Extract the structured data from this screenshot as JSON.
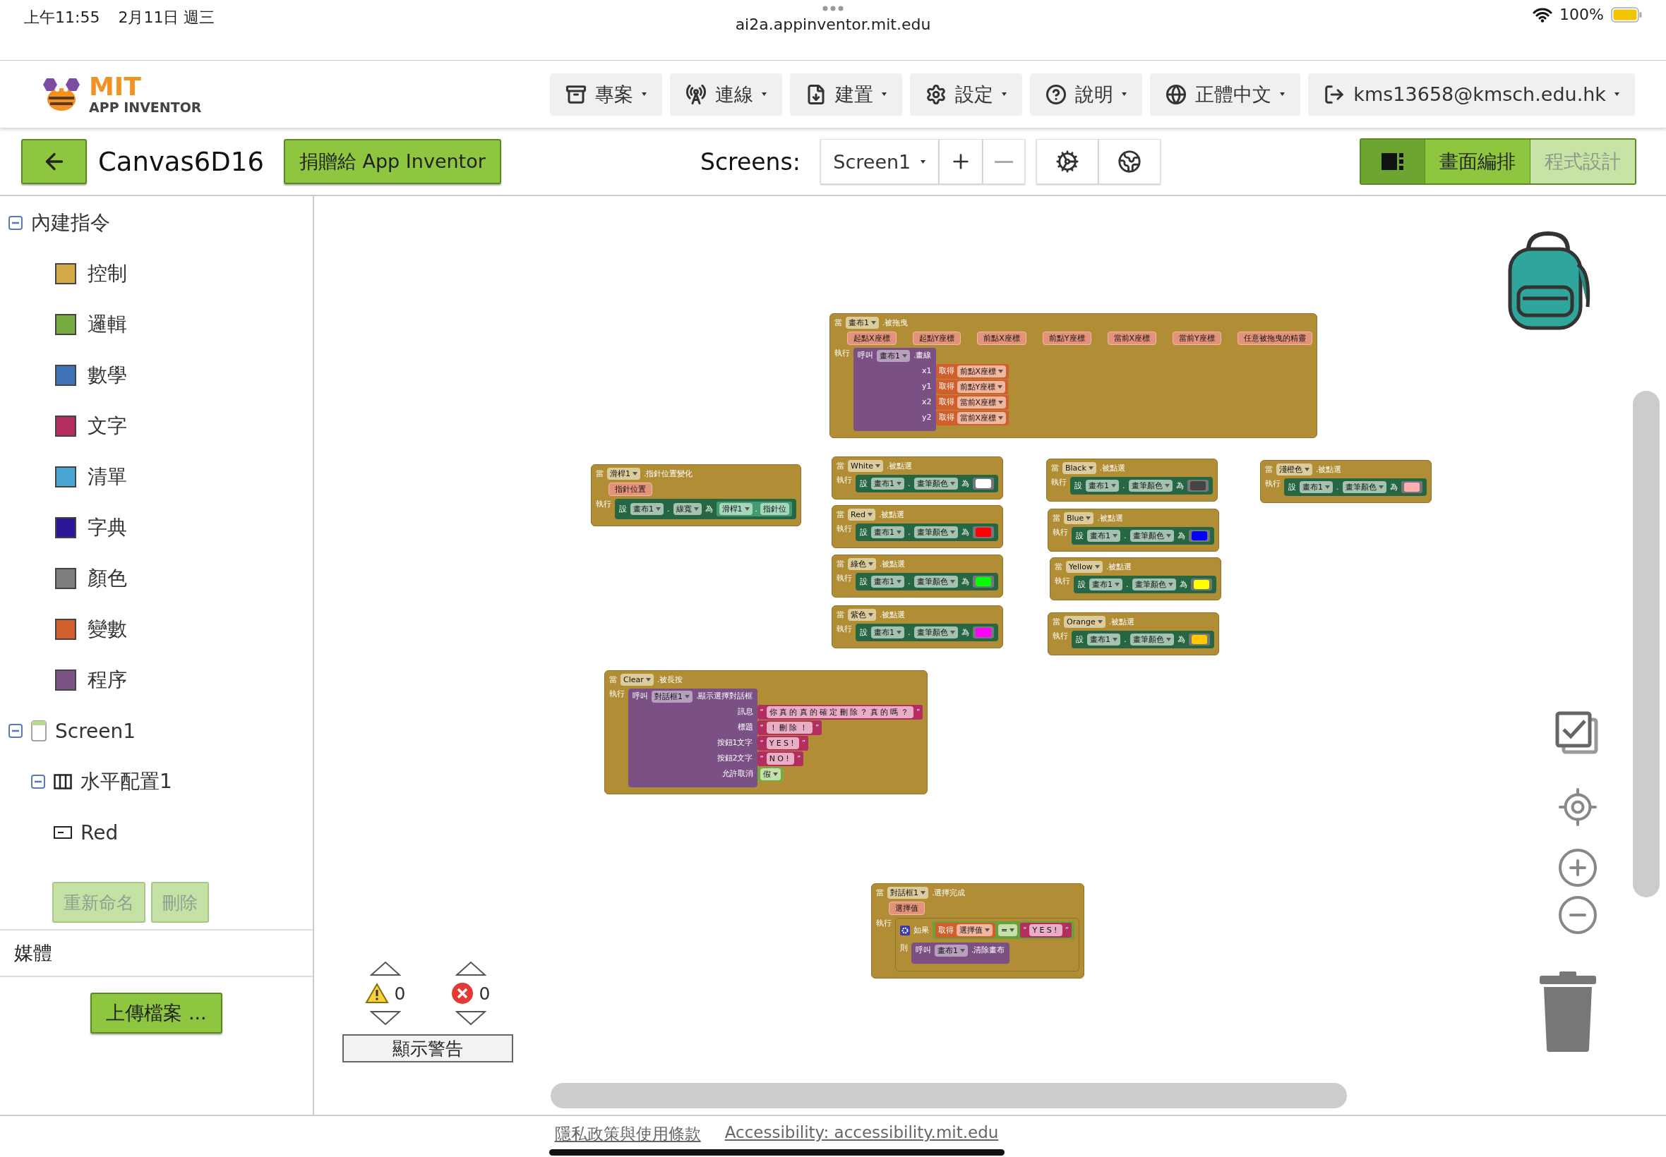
{
  "status_bar": {
    "time": "上午11:55",
    "date": "2月11日 週三",
    "url": "ai2a.appinventor.mit.edu",
    "battery": "100%"
  },
  "header": {
    "logo_title": "MIT",
    "logo_subtitle": "APP INVENTOR",
    "menus": [
      {
        "label": "專案"
      },
      {
        "label": "連線"
      },
      {
        "label": "建置"
      },
      {
        "label": "設定"
      },
      {
        "label": "說明"
      },
      {
        "label": "正體中文"
      },
      {
        "label": "kms13658@kmsch.edu.hk"
      }
    ]
  },
  "toolbar": {
    "project_name": "Canvas6D16",
    "donate": "捐贈給 App Inventor",
    "screens_label": "Screens:",
    "screen": "Screen1",
    "add_disabled": false,
    "remove_disabled": true,
    "editor_tabs": [
      {
        "label": "畫面編排",
        "selected": false
      },
      {
        "label": "程式設計",
        "selected": true
      }
    ]
  },
  "sidebar": {
    "tree": [
      {
        "kind": "group",
        "label": "內建指令",
        "expanded": true,
        "children": [
          {
            "kind": "category",
            "label": "控制",
            "color": "#d4aa48"
          },
          {
            "kind": "category",
            "label": "邏輯",
            "color": "#77ab41"
          },
          {
            "kind": "category",
            "label": "數學",
            "color": "#3f71b5"
          },
          {
            "kind": "category",
            "label": "文字",
            "color": "#b32d5e"
          },
          {
            "kind": "category",
            "label": "清單",
            "color": "#49a6d4"
          },
          {
            "kind": "category",
            "label": "字典",
            "color": "#2d1799"
          },
          {
            "kind": "category",
            "label": "顏色",
            "color": "#7d7d7d"
          },
          {
            "kind": "category",
            "label": "變數",
            "color": "#d05f2d"
          },
          {
            "kind": "category",
            "label": "程序",
            "color": "#7c5385"
          }
        ]
      },
      {
        "kind": "screen",
        "label": "Screen1",
        "expanded": true,
        "children": [
          {
            "kind": "arrangement",
            "label": "水平配置1",
            "expanded": true,
            "children": [
              {
                "kind": "button",
                "label": "Red"
              }
            ]
          }
        ]
      }
    ],
    "actions": [
      {
        "label": "重新命名",
        "disabled": true
      },
      {
        "label": "刪除",
        "disabled": true
      }
    ],
    "media_title": "媒體",
    "upload": "上傳檔案 ..."
  },
  "workspace": {
    "blocks": [
      {
        "kind": "event",
        "when": "當",
        "component": "畫布1",
        "event": ".被拖曳",
        "params": [
          "起點X座標",
          "起點Y座標",
          "前點X座標",
          "前點Y座標",
          "當前X座標",
          "當前Y座標",
          "任意被拖曳的精靈"
        ],
        "do": "執行",
        "body": [
          {
            "kind": "call",
            "word": "呼叫",
            "component": "畫布1",
            "method": ".畫線",
            "args": [
              {
                "label": "x1",
                "value": {
                  "kind": "get",
                  "word": "取得",
                  "name": "前點X座標"
                }
              },
              {
                "label": "y1",
                "value": {
                  "kind": "get",
                  "word": "取得",
                  "name": "前點Y座標"
                }
              },
              {
                "label": "x2",
                "value": {
                  "kind": "get",
                  "word": "取得",
                  "name": "當前X座標"
                }
              },
              {
                "label": "y2",
                "value": {
                  "kind": "get",
                  "word": "取得",
                  "name": "當前X座標"
                }
              }
            ]
          }
        ]
      },
      {
        "kind": "event",
        "when": "當",
        "component": "滑桿1",
        "event": ".指針位置變化",
        "params": [
          "指針位置"
        ],
        "do": "執行",
        "body": [
          {
            "kind": "set",
            "word": "設",
            "component": "畫布1",
            "dot": ".",
            "property": "線寬",
            "to": "為",
            "value": {
              "kind": "property",
              "component": "滑桿1",
              "dot": ".",
              "property": "指針位"
            }
          }
        ]
      },
      {
        "kind": "event",
        "when": "當",
        "component": "White",
        "event": ".被點選",
        "do": "執行",
        "body": [
          {
            "kind": "set",
            "word": "設",
            "component": "畫布1",
            "dot": ".",
            "property": "畫筆顏色",
            "to": "為",
            "value": {
              "kind": "color",
              "color": "#ffffff"
            }
          }
        ]
      },
      {
        "kind": "event",
        "when": "當",
        "component": "Red",
        "event": ".被點選",
        "do": "執行",
        "body": [
          {
            "kind": "set",
            "word": "設",
            "component": "畫布1",
            "dot": ".",
            "property": "畫筆顏色",
            "to": "為",
            "value": {
              "kind": "color",
              "color": "#ff0000"
            }
          }
        ]
      },
      {
        "kind": "event",
        "when": "當",
        "component": "綠色",
        "event": ".被點選",
        "do": "執行",
        "body": [
          {
            "kind": "set",
            "word": "設",
            "component": "畫布1",
            "dot": ".",
            "property": "畫筆顏色",
            "to": "為",
            "value": {
              "kind": "color",
              "color": "#00ff00"
            }
          }
        ]
      },
      {
        "kind": "event",
        "when": "當",
        "component": "紫色",
        "event": ".被點選",
        "do": "執行",
        "body": [
          {
            "kind": "set",
            "word": "設",
            "component": "畫布1",
            "dot": ".",
            "property": "畫筆顏色",
            "to": "為",
            "value": {
              "kind": "color",
              "color": "#ff00ff"
            }
          }
        ]
      },
      {
        "kind": "event",
        "when": "當",
        "component": "Black",
        "event": ".被點選",
        "do": "執行",
        "body": [
          {
            "kind": "set",
            "word": "設",
            "component": "畫布1",
            "dot": ".",
            "property": "畫筆顏色",
            "to": "為",
            "value": {
              "kind": "color",
              "color": "#444444"
            }
          }
        ]
      },
      {
        "kind": "event",
        "when": "當",
        "component": "Blue",
        "event": ".被點選",
        "do": "執行",
        "body": [
          {
            "kind": "set",
            "word": "設",
            "component": "畫布1",
            "dot": ".",
            "property": "畫筆顏色",
            "to": "為",
            "value": {
              "kind": "color",
              "color": "#0000ff"
            }
          }
        ]
      },
      {
        "kind": "event",
        "when": "當",
        "component": "Yellow",
        "event": ".被點選",
        "do": "執行",
        "body": [
          {
            "kind": "set",
            "word": "設",
            "component": "畫布1",
            "dot": ".",
            "property": "畫筆顏色",
            "to": "為",
            "value": {
              "kind": "color",
              "color": "#ffff00"
            }
          }
        ]
      },
      {
        "kind": "event",
        "when": "當",
        "component": "Orange",
        "event": ".被點選",
        "do": "執行",
        "body": [
          {
            "kind": "set",
            "word": "設",
            "component": "畫布1",
            "dot": ".",
            "property": "畫筆顏色",
            "to": "為",
            "value": {
              "kind": "color",
              "color": "#ffc800"
            }
          }
        ]
      },
      {
        "kind": "event",
        "when": "當",
        "component": "淺橙色",
        "event": ".被點選",
        "do": "執行",
        "body": [
          {
            "kind": "set",
            "word": "設",
            "component": "畫布1",
            "dot": ".",
            "property": "畫筆顏色",
            "to": "為",
            "value": {
              "kind": "color",
              "color": "#ffafaf"
            }
          }
        ]
      },
      {
        "kind": "event",
        "when": "當",
        "component": "Clear",
        "event": ".被長按",
        "do": "執行",
        "body": [
          {
            "kind": "call",
            "word": "呼叫",
            "component": "對話框1",
            "method": ".顯示選擇對話框",
            "args": [
              {
                "label": "訊息",
                "value": {
                  "kind": "text",
                  "open": "“",
                  "text": "你真的真的確定刪除？真的嗎？",
                  "close": "”"
                }
              },
              {
                "label": "標題",
                "value": {
                  "kind": "text",
                  "open": "“",
                  "text": "！刪除！",
                  "close": "”"
                }
              },
              {
                "label": "按鈕1文字",
                "value": {
                  "kind": "text",
                  "open": "“",
                  "text": "YES!",
                  "close": "”"
                }
              },
              {
                "label": "按鈕2文字",
                "value": {
                  "kind": "text",
                  "open": "“",
                  "text": "NO!",
                  "close": "”"
                }
              },
              {
                "label": "允許取消",
                "value": {
                  "kind": "logic",
                  "value": "假"
                }
              }
            ]
          }
        ]
      },
      {
        "kind": "event",
        "when": "當",
        "component": "對話框1",
        "event": ".選擇完成",
        "params": [
          "選擇值"
        ],
        "do": "執行",
        "body": [
          {
            "kind": "if",
            "word": "如果",
            "then": "則",
            "condition": {
              "kind": "compare",
              "left": {
                "kind": "get",
                "word": "取得",
                "name": "選擇值"
              },
              "op": "=",
              "right": {
                "kind": "text",
                "open": "“",
                "text": "YES!",
                "close": "”"
              }
            },
            "body": [
              {
                "kind": "call",
                "word": "呼叫",
                "component": "畫布1",
                "method": ".清除畫布"
              }
            ]
          }
        ]
      }
    ],
    "warning_count": "0",
    "error_count": "0",
    "show_warnings": "顯示警告"
  },
  "footer": {
    "links": [
      "隱私政策與使用條款",
      "Accessibility: accessibility.mit.edu"
    ]
  }
}
